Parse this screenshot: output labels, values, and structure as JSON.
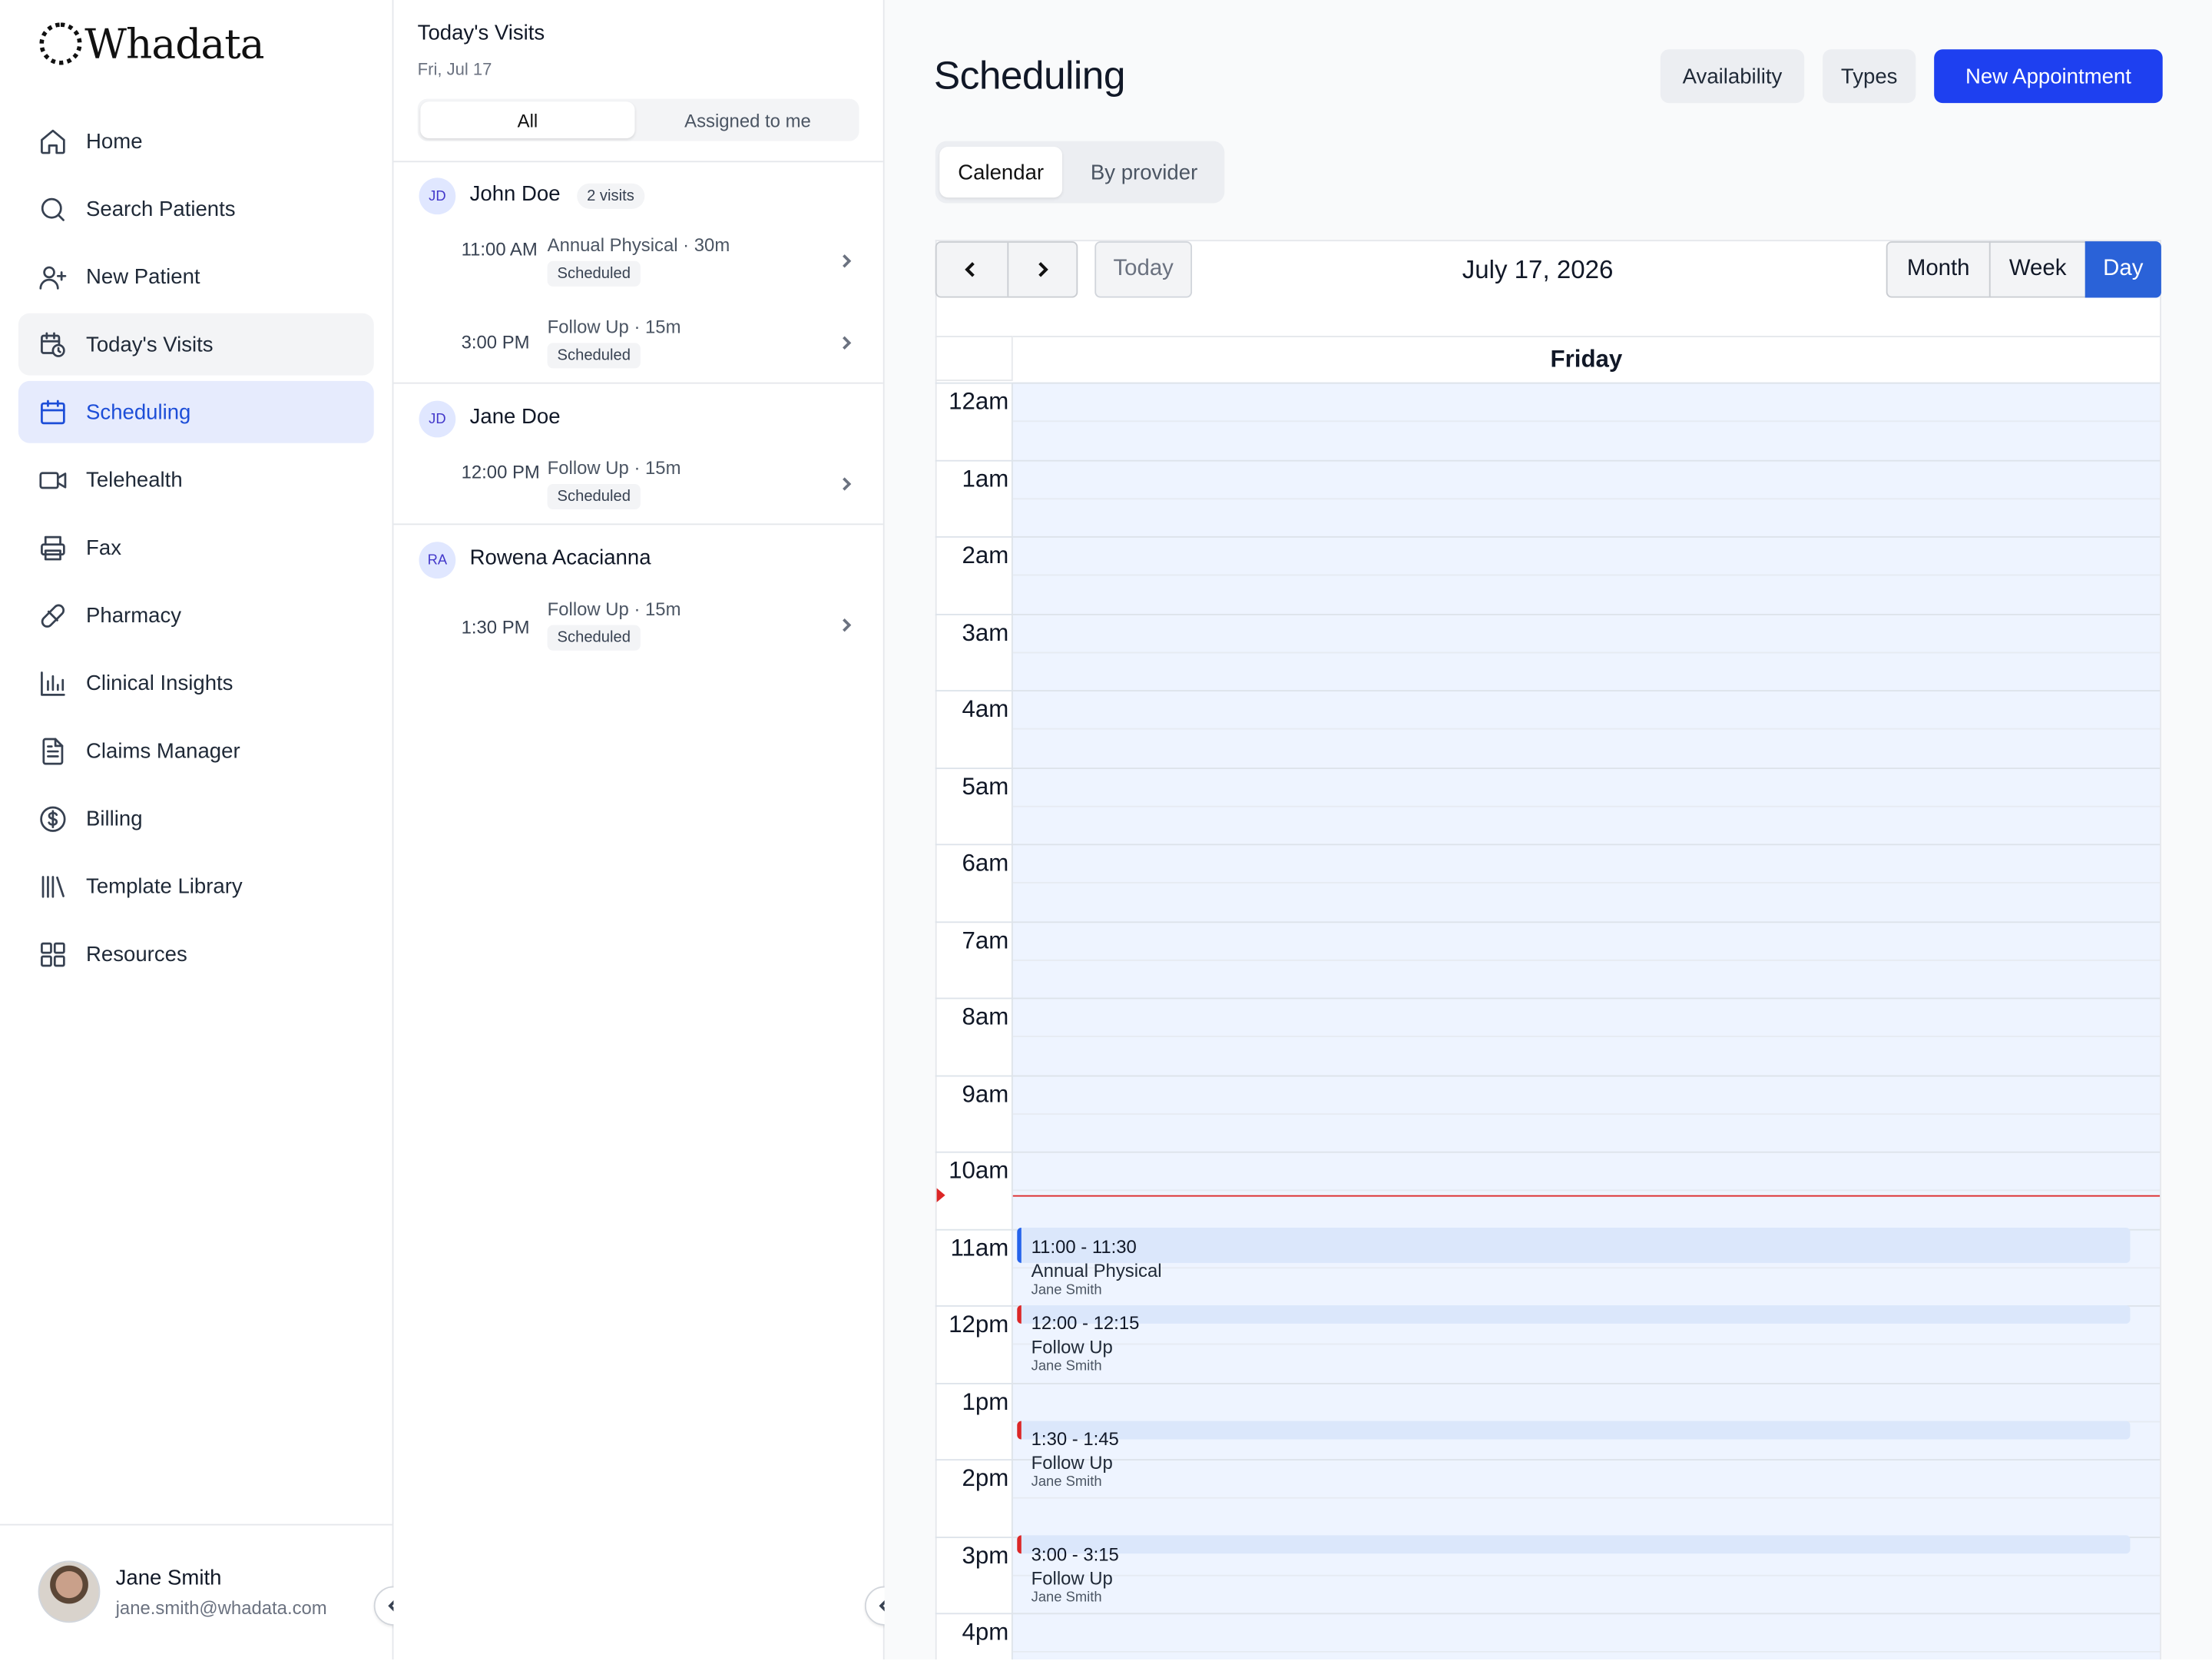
{
  "brand": {
    "name": "Whadata"
  },
  "sidebar": {
    "items": [
      {
        "label": "Home",
        "icon": "home-icon"
      },
      {
        "label": "Search Patients",
        "icon": "search-icon"
      },
      {
        "label": "New Patient",
        "icon": "user-plus-icon"
      },
      {
        "label": "Today's Visits",
        "icon": "calendar-clock-icon"
      },
      {
        "label": "Scheduling",
        "icon": "calendar-icon"
      },
      {
        "label": "Telehealth",
        "icon": "video-icon"
      },
      {
        "label": "Fax",
        "icon": "printer-icon"
      },
      {
        "label": "Pharmacy",
        "icon": "pill-icon"
      },
      {
        "label": "Clinical Insights",
        "icon": "bar-chart-icon"
      },
      {
        "label": "Claims Manager",
        "icon": "document-icon"
      },
      {
        "label": "Billing",
        "icon": "dollar-circle-icon"
      },
      {
        "label": "Template Library",
        "icon": "library-icon"
      },
      {
        "label": "Resources",
        "icon": "grid-icon"
      }
    ],
    "active": "Scheduling",
    "user": {
      "name": "Jane Smith",
      "email": "jane.smith@whadata.com"
    }
  },
  "visits": {
    "title": "Today's Visits",
    "date": "Fri, Jul 17",
    "filters": {
      "all": "All",
      "assigned": "Assigned to me"
    },
    "patients": [
      {
        "initials": "JD",
        "name": "John Doe",
        "badge": "2 visits",
        "appointments": [
          {
            "time": "11:00 AM",
            "type": "Annual Physical · 30m",
            "status": "Scheduled"
          },
          {
            "time": "3:00 PM",
            "type": "Follow Up · 15m",
            "status": "Scheduled"
          }
        ]
      },
      {
        "initials": "JD",
        "name": "Jane Doe",
        "appointments": [
          {
            "time": "12:00 PM",
            "type": "Follow Up · 15m",
            "status": "Scheduled"
          }
        ]
      },
      {
        "initials": "RA",
        "name": "Rowena Acacianna",
        "appointments": [
          {
            "time": "1:30 PM",
            "type": "Follow Up · 15m",
            "status": "Scheduled"
          }
        ]
      }
    ]
  },
  "main": {
    "title": "Scheduling",
    "buttons": {
      "availability": "Availability",
      "types": "Types",
      "new_appointment": "New Appointment"
    },
    "view_tabs": {
      "calendar": "Calendar",
      "by_provider": "By provider"
    },
    "calendar": {
      "today_label": "Today",
      "date": "July 17, 2026",
      "ranges": {
        "month": "Month",
        "week": "Week",
        "day": "Day"
      },
      "selected_range": "Day",
      "day_name": "Friday",
      "hours": [
        "12am",
        "1am",
        "2am",
        "3am",
        "4am",
        "5am",
        "6am",
        "7am",
        "8am",
        "9am",
        "10am",
        "11am",
        "12pm",
        "1pm",
        "2pm",
        "3pm",
        "4pm"
      ],
      "events": [
        {
          "time": "11:00 - 11:30",
          "title": "Annual Physical",
          "provider": "Jane Smith",
          "accent": "#2563eb"
        },
        {
          "time": "12:00 - 12:15",
          "title": "Follow Up",
          "provider": "Jane Smith",
          "accent": "#dc2626"
        },
        {
          "time": "1:30 - 1:45",
          "title": "Follow Up",
          "provider": "Jane Smith",
          "accent": "#dc2626"
        },
        {
          "time": "3:00 - 3:15",
          "title": "Follow Up",
          "provider": "Jane Smith",
          "accent": "#dc2626"
        }
      ]
    }
  },
  "colors": {
    "accent": "#1e40f0",
    "active_nav_bg": "#e6ebfd",
    "calendar_bg": "#eef4ff",
    "now_line": "#dc2626"
  }
}
